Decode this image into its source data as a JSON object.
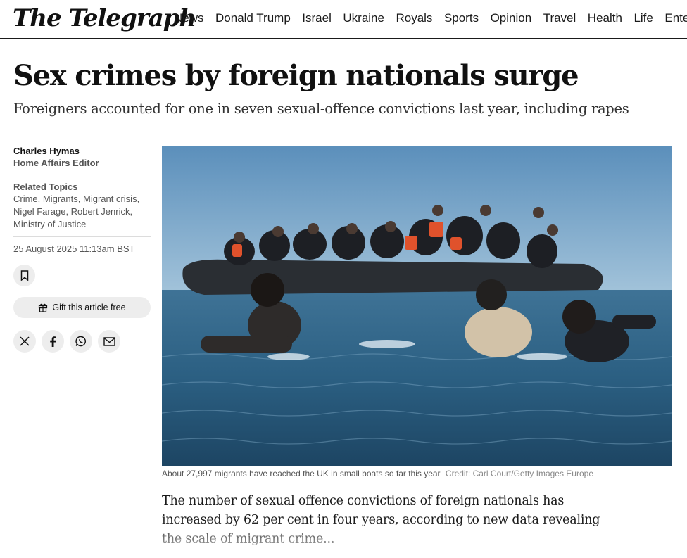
{
  "masthead": "The Telegraph",
  "nav": [
    "News",
    "Donald Trump",
    "Israel",
    "Ukraine",
    "Royals",
    "Sports",
    "Opinion",
    "Travel",
    "Health",
    "Life",
    "Entertainment"
  ],
  "article": {
    "headline": "Sex crimes by foreign nationals surge",
    "standfirst": "Foreigners accounted for one in seven sexual-offence convictions last year, including rapes",
    "author": {
      "name": "Charles Hymas",
      "role": "Home Affairs Editor"
    },
    "related_topics_label": "Related Topics",
    "related_topics": [
      "Crime",
      "Migrants",
      "Migrant crisis",
      "Nigel Farage",
      "Robert Jenrick",
      "Ministry of Justice"
    ],
    "date": "25 August 2025 11:13am BST",
    "gift_label": "Gift this article free",
    "share_icons": [
      "x-icon",
      "facebook-icon",
      "whatsapp-icon",
      "email-icon"
    ],
    "image": {
      "caption": "About 27,997 migrants have reached the UK in small boats so far this year",
      "credit": "Credit: Carl Court/Getty Images Europe"
    },
    "body": "The number of sexual offence convictions of foreign nationals has increased by 62 per cent in four years, according to new data revealing the scale of migrant crime..."
  },
  "colors": {
    "text": "#1a1a1a",
    "muted": "#555555",
    "pill": "#ededed",
    "sea": "#2b5f82",
    "sky": "#5f93bd"
  }
}
